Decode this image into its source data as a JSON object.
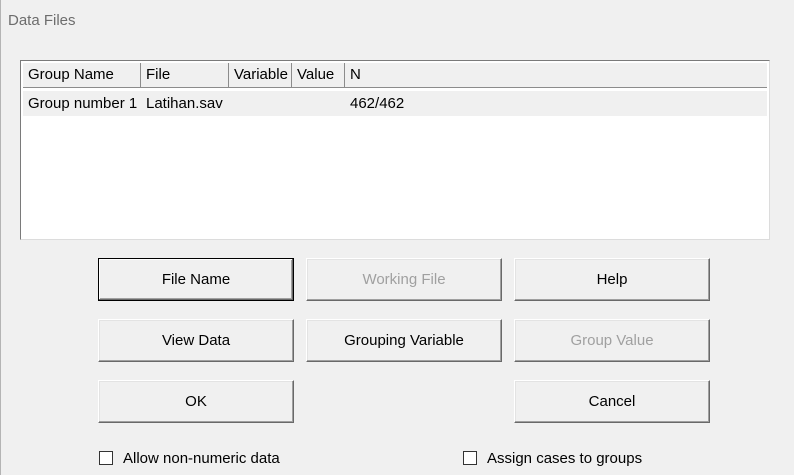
{
  "window": {
    "title": "Data Files"
  },
  "list": {
    "columns": [
      "Group Name",
      "File",
      "Variable",
      "Value",
      "N"
    ],
    "rows": [
      {
        "group_name": "Group number 1",
        "file": "Latihan.sav",
        "variable": "",
        "value": "",
        "n": "462/462"
      }
    ]
  },
  "buttons": {
    "file_name": "File Name",
    "working_file": "Working File",
    "help": "Help",
    "view_data": "View Data",
    "grouping_variable": "Grouping Variable",
    "group_value": "Group Value",
    "ok": "OK",
    "cancel": "Cancel"
  },
  "checkboxes": {
    "allow_non_numeric": {
      "label": "Allow non-numeric data",
      "checked": false
    },
    "assign_cases": {
      "label": "Assign cases to groups",
      "checked": false
    }
  }
}
